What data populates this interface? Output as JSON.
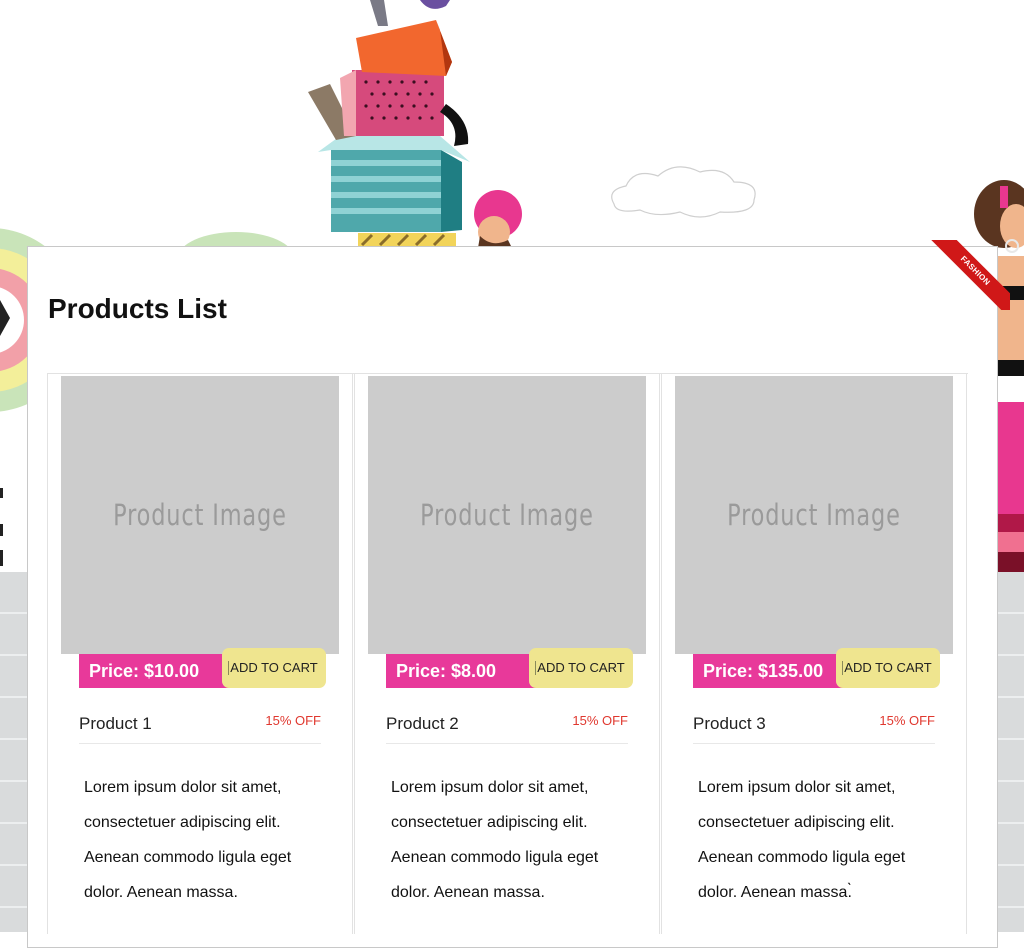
{
  "colors": {
    "price_bg": "#e8399a",
    "cart_bg": "#efe58f",
    "discount": "#e0382f",
    "ribbon": "#d01818",
    "image_placeholder": "#cccccc"
  },
  "ribbon": {
    "label": "FASHION"
  },
  "page": {
    "title": "Products List"
  },
  "products": [
    {
      "image_text": "Product Image",
      "price": "Price: $10.00",
      "cart_label": "ADD TO CART",
      "name": "Product 1",
      "discount": "15% OFF",
      "description": "Lorem ipsum dolor sit amet, consectetuer adipiscing elit. Aenean commodo ligula eget dolor. Aenean massa."
    },
    {
      "image_text": "Product Image",
      "price": "Price: $8.00",
      "cart_label": "ADD TO CART",
      "name": "Product 2",
      "discount": "15% OFF",
      "description": "Lorem ipsum dolor sit amet, consectetuer adipiscing elit. Aenean commodo ligula eget dolor. Aenean massa."
    },
    {
      "image_text": "Product Image",
      "price": "Price: $135.00",
      "cart_label": "ADD TO CART",
      "name": "Product 3",
      "discount": "15% OFF",
      "description": "Lorem ipsum dolor sit amet, consectetuer adipiscing elit. Aenean commodo ligula eget dolor. Aenean massa.̀"
    }
  ]
}
